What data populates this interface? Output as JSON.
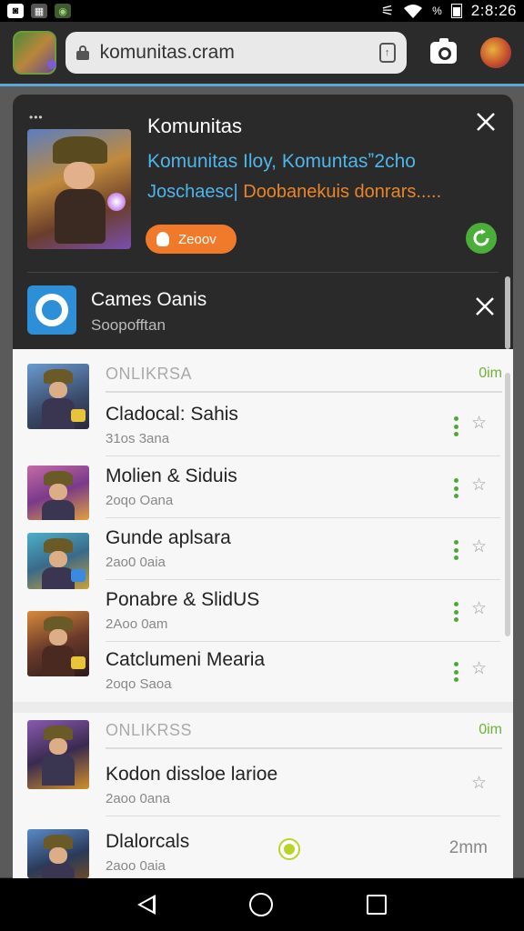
{
  "status_bar": {
    "time": "2:8:26",
    "battery": "%"
  },
  "browser": {
    "url": "komunitas.cram",
    "url_action_icon": "tab-count-icon"
  },
  "notification": {
    "dots": "•••",
    "title": "Komunitas",
    "body_line1": "Komunitas Iloy, Komuntasˮ2cho",
    "body_line2_part1": "Joschaesc|",
    "body_line2_part2": " Doobanekuis donrars.....",
    "pill_label": "Zeoov"
  },
  "group": {
    "title": "Cames Oanis",
    "subtitle": "Soopofftan"
  },
  "sections": [
    {
      "label": "ONLIKRSA",
      "count": "0im",
      "items": [
        {
          "title": "Cladocal: Sahis",
          "sub": "31os 3ana"
        },
        {
          "title": "Molien & Siduis",
          "sub": "2oqo Oana"
        },
        {
          "title": "Gunde aplsara",
          "sub": "2ao0 0aia"
        },
        {
          "title": "Ponabre & SlidUS",
          "sub": "2Aoo 0am"
        },
        {
          "title": "Catclumeni Mearia",
          "sub": "2oqo Saoa"
        }
      ]
    },
    {
      "label": "ONLIKRSS",
      "count": "0im",
      "items": [
        {
          "title": "Kodon dissloe larioe",
          "sub": "2aoo 0ana"
        },
        {
          "title": "Dlalorcals",
          "sub": "2aoo 0aia",
          "time": "2mm"
        }
      ]
    }
  ],
  "colors": {
    "accent_blue": "#4fb5e8",
    "accent_orange": "#f0792a",
    "accent_green": "#4cae3a"
  }
}
